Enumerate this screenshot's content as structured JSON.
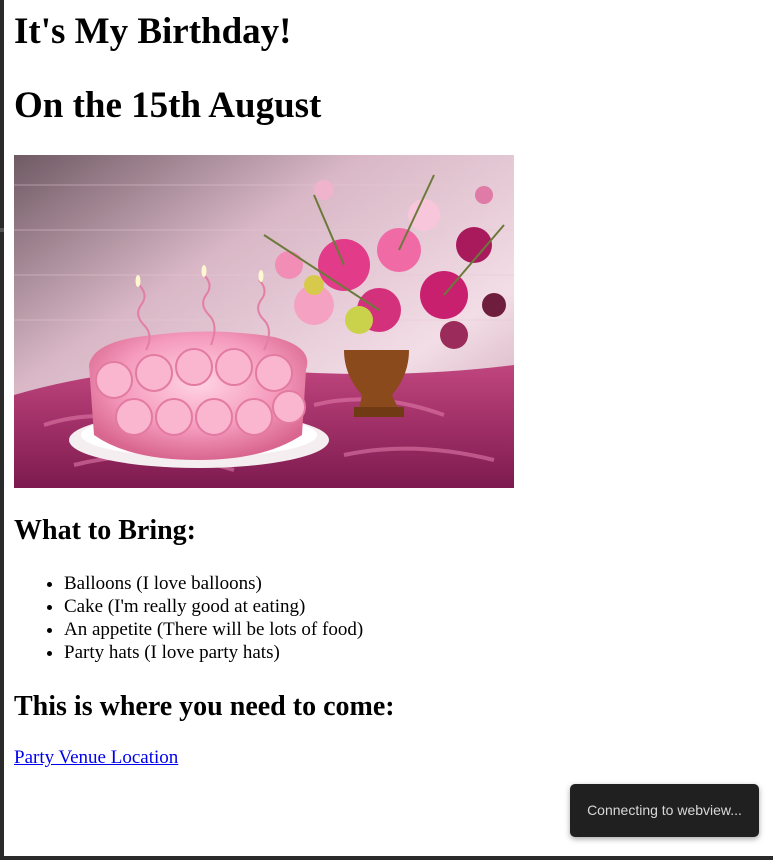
{
  "page": {
    "title": "It's My Birthday!",
    "subtitle": "On the 15th August",
    "bring_heading": "What to Bring:",
    "bring_items": [
      "Balloons (I love balloons)",
      "Cake (I'm really good at eating)",
      "An appetite (There will be lots of food)",
      "Party hats (I love party hats)"
    ],
    "location_heading": "This is where you need to come:",
    "location_link": "Party Venue Location"
  },
  "toast": {
    "text": "Connecting to webview..."
  },
  "colors": {
    "link": "#0000ee",
    "toast_bg": "#202020",
    "toast_text": "#d8d8d8"
  }
}
